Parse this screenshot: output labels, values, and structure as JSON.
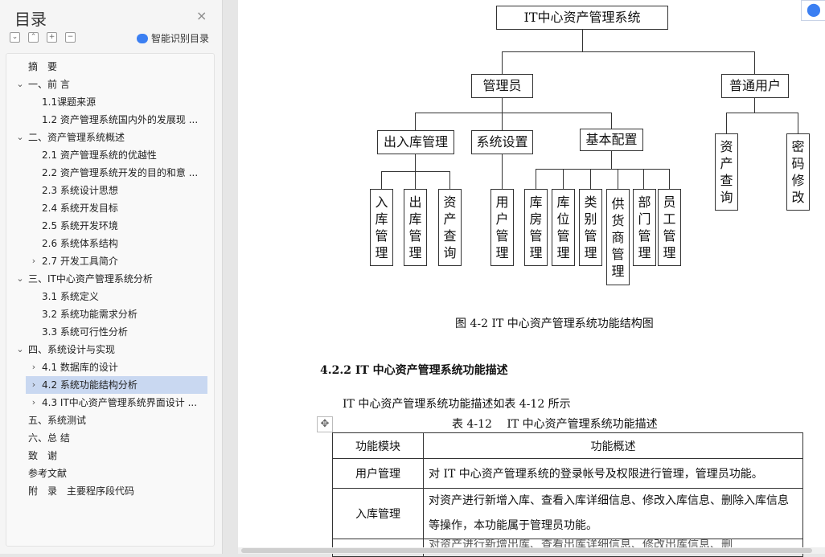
{
  "sidebar": {
    "title": "目录",
    "close_icon": "×",
    "tools": [
      "⌄",
      "⌃",
      "+",
      "−"
    ],
    "smart_label": "智能识别目录",
    "items": [
      {
        "label": "摘　要"
      },
      {
        "label": "一、前 言"
      },
      {
        "label": "1.1课题来源"
      },
      {
        "label": "1.2 资产管理系统国内外的发展现 ..."
      },
      {
        "label": "二、资产管理系统概述"
      },
      {
        "label": "2.1 资产管理系统的优越性"
      },
      {
        "label": "2.2 资产管理系统开发的目的和意 ..."
      },
      {
        "label": "2.3 系统设计思想"
      },
      {
        "label": "2.4 系统开发目标"
      },
      {
        "label": "2.5 系统开发环境"
      },
      {
        "label": "2.6 系统体系结构"
      },
      {
        "label": "2.7 开发工具简介"
      },
      {
        "label": "三、IT中心资产管理系统分析"
      },
      {
        "label": "3.1 系统定义"
      },
      {
        "label": "3.2 系统功能需求分析"
      },
      {
        "label": "3.3 系统可行性分析"
      },
      {
        "label": "四、系统设计与实现"
      },
      {
        "label": "4.1 数据库的设计"
      },
      {
        "label": "4.2 系统功能结构分析"
      },
      {
        "label": "4.3 IT中心资产管理系统界面设计 ..."
      },
      {
        "label": "五、系统测试"
      },
      {
        "label": "六、总 结"
      },
      {
        "label": "致　谢"
      },
      {
        "label": "参考文献"
      },
      {
        "label": "附　录　主要程序段代码"
      }
    ]
  },
  "diagram": {
    "root": "IT中心资产管理系统",
    "admin": "管理员",
    "user": "普通用户",
    "inout": "出入库管理",
    "settings": "系统设置",
    "basic": "基本配置",
    "leaves_inout": [
      "入库管理",
      "出库管理",
      "资产查询"
    ],
    "leaves_settings": [
      "用户管理"
    ],
    "leaves_basic": [
      "库房管理",
      "库位管理",
      "类别管理",
      "供货商管理",
      "部门管理",
      "员工管理"
    ],
    "leaves_user": [
      "资产查询",
      "密码修改"
    ]
  },
  "figure_caption": "图 4-2 IT 中心资产管理系统功能结构图",
  "section_heading": "4.2.2 IT 中心资产管理系统功能描述",
  "paragraph": "IT 中心资产管理系统功能描述如表 4-12 所示",
  "table_caption": "表 4-12　 IT 中心资产管理系统功能描述",
  "table": {
    "headers": [
      "功能模块",
      "功能概述"
    ],
    "rows": [
      {
        "module": "用户管理",
        "desc": "对 IT 中心资产管理系统的登录帐号及权限进行管理，管理员功能。"
      },
      {
        "module": "入库管理",
        "desc": "对资产进行新增入库、查看入库详细信息、修改入库信息、删除入库信息等操作，本功能属于管理员功能。"
      }
    ],
    "partial_row": "对资产进行新增出库、查看出库详细信息、修改出库信息、删"
  },
  "colors": {
    "selection": "#c9d8f1",
    "accent": "#3b7ff2"
  }
}
